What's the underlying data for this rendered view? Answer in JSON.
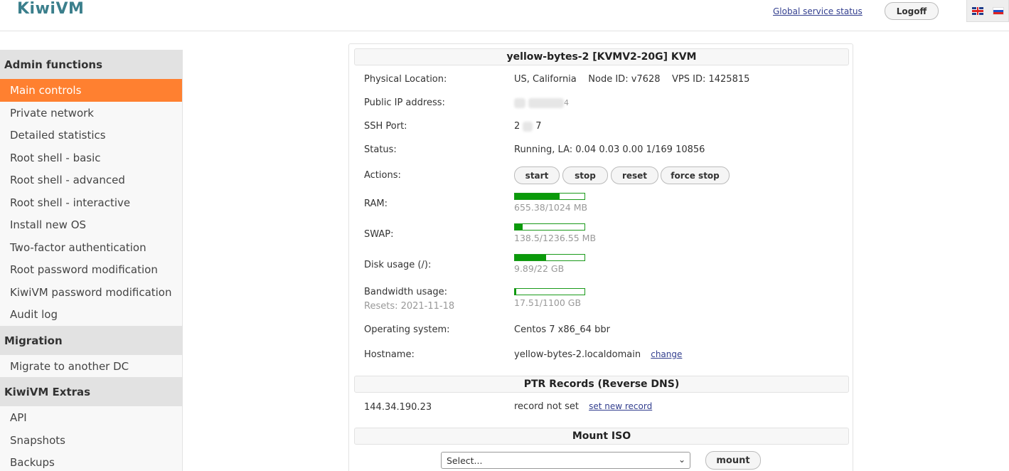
{
  "header": {
    "logo": "KiwiVM",
    "global_status_link": "Global service status",
    "logoff_label": "Logoff",
    "languages": [
      "English",
      "Russian"
    ]
  },
  "sidebar": {
    "sections": [
      {
        "title": "Admin functions",
        "items": [
          {
            "label": "Main controls",
            "active": true
          },
          {
            "label": "Private network"
          },
          {
            "label": "Detailed statistics"
          },
          {
            "label": "Root shell - basic"
          },
          {
            "label": "Root shell - advanced"
          },
          {
            "label": "Root shell - interactive"
          },
          {
            "label": "Install new OS"
          },
          {
            "label": "Two-factor authentication"
          },
          {
            "label": "Root password modification"
          },
          {
            "label": "KiwiVM password modification"
          },
          {
            "label": "Audit log"
          }
        ]
      },
      {
        "title": "Migration",
        "items": [
          {
            "label": "Migrate to another DC"
          }
        ]
      },
      {
        "title": "KiwiVM Extras",
        "items": [
          {
            "label": "API"
          },
          {
            "label": "Snapshots"
          },
          {
            "label": "Backups"
          }
        ]
      }
    ]
  },
  "vps": {
    "title": "yellow-bytes-2   [KVMV2-20G]   KVM",
    "physical_location_label": "Physical Location:",
    "physical_location_value": "US, California    Node ID: v7628    VPS ID: 1425815",
    "public_ip_label": "Public IP address:",
    "public_ip_visible": "4",
    "ssh_port_label": "SSH Port:",
    "ssh_port_start": "2",
    "ssh_port_end": "7",
    "status_label": "Status:",
    "status_value": "Running, LA: 0.04 0.03 0.00 1/169 10856",
    "actions_label": "Actions:",
    "actions": [
      "start",
      "stop",
      "reset",
      "force stop"
    ],
    "ram_label": "RAM:",
    "ram_text": "655.38/1024 MB",
    "ram_fraction": 0.64,
    "swap_label": "SWAP:",
    "swap_text": "138.5/1236.55 MB",
    "swap_fraction": 0.11,
    "disk_label": "Disk usage (/):",
    "disk_text": "9.89/22 GB",
    "disk_fraction": 0.45,
    "bandwidth_label": "Bandwidth usage:",
    "bandwidth_reset": "Resets: 2021-11-18",
    "bandwidth_text": "17.51/1100 GB",
    "bandwidth_fraction": 0.016,
    "os_label": "Operating system:",
    "os_value": "Centos 7 x86_64 bbr",
    "hostname_label": "Hostname:",
    "hostname_value": "yellow-bytes-2.localdomain",
    "hostname_change": "change"
  },
  "ptr": {
    "title": "PTR Records (Reverse DNS)",
    "ip": "144.34.190.23",
    "record_status": "record not set",
    "set_link": "set new record"
  },
  "iso": {
    "title": "Mount ISO",
    "select_value": "Select...",
    "mount_label": "mount"
  },
  "colors": {
    "logo": "#3b7f8c",
    "active_nav": "#ff8030",
    "usage_bar": "#0a9a0a",
    "link": "#333f8f"
  }
}
